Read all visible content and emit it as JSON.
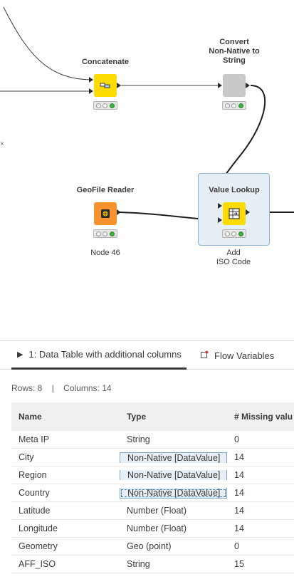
{
  "workflow": {
    "nodes": {
      "concatenate": {
        "title": "Concatenate"
      },
      "convert": {
        "title_lines": [
          "Convert",
          "Non-Native to",
          "String"
        ]
      },
      "geofile_reader": {
        "title": "GeoFile Reader",
        "label": "Node 46"
      },
      "value_lookup": {
        "title": "Value Lookup",
        "label_lines": [
          "Add",
          "ISO Code"
        ]
      }
    },
    "left_edge_glyph": "×"
  },
  "panel": {
    "tabs": [
      {
        "label": "1: Data Table with additional columns",
        "icon": "play-icon",
        "active": true
      },
      {
        "label": "Flow Variables",
        "icon": "flow-variable-icon",
        "active": false
      }
    ],
    "stats": {
      "rows": "Rows: 8",
      "columns": "Columns: 14",
      "separator": "|"
    },
    "table": {
      "headers": [
        "Name",
        "Type",
        "# Missing valu"
      ],
      "rows": [
        {
          "name": "Meta IP",
          "type": "String",
          "missing": "0"
        },
        {
          "name": "City",
          "type": "Non-Native [DataValue]",
          "missing": "14"
        },
        {
          "name": "Region",
          "type": "Non-Native [DataValue]",
          "missing": "14"
        },
        {
          "name": "Country",
          "type": "Non-Native [DataValue]",
          "missing": "14"
        },
        {
          "name": "Latitude",
          "type": "Number (Float)",
          "missing": "14"
        },
        {
          "name": "Longitude",
          "type": "Number (Float)",
          "missing": "14"
        },
        {
          "name": "Geometry",
          "type": "Geo (point)",
          "missing": "0"
        },
        {
          "name": "AFF_ISO",
          "type": "String",
          "missing": "15"
        }
      ]
    }
  }
}
